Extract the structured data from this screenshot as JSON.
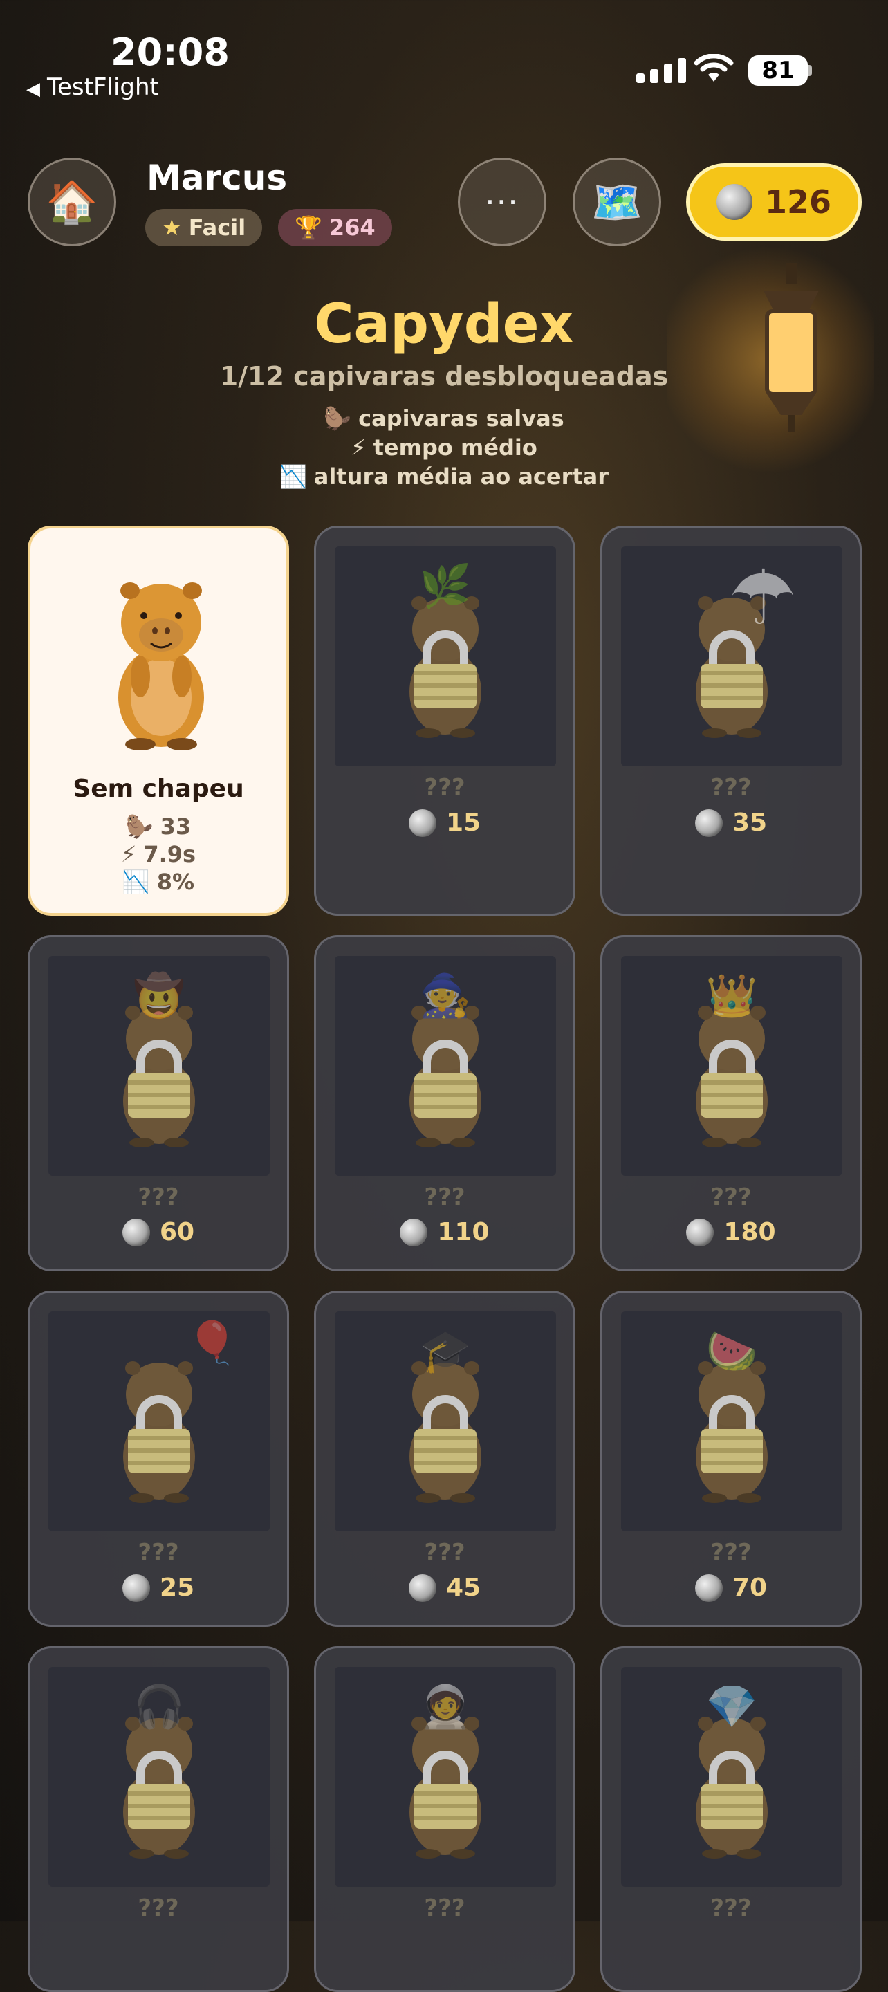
{
  "status_bar": {
    "time": "20:08",
    "back_label": "TestFlight",
    "battery": "81"
  },
  "header": {
    "home_icon": "🏠",
    "username": "Marcus",
    "level_icon": "★",
    "level": "Facil",
    "trophy_icon": "🏆",
    "trophies": "264",
    "more_label": "···",
    "map_icon": "🗺️",
    "coins": "126"
  },
  "page": {
    "title": "Capydex",
    "subtitle": "1/12 capivaras desbloqueadas",
    "legend": [
      {
        "icon": "🦫",
        "label": "capivaras salvas"
      },
      {
        "icon": "⚡",
        "label": "tempo médio"
      },
      {
        "icon": "📉",
        "label": "altura média ao acertar"
      }
    ]
  },
  "cards": [
    {
      "unlocked": true,
      "name": "Sem chapeu",
      "saved_icon": "🦫",
      "saved": "33",
      "time_icon": "⚡",
      "time": "7.9s",
      "height_icon": "📉",
      "height": "8%"
    },
    {
      "unlocked": false,
      "name": "???",
      "price": "15",
      "hat": "leaf"
    },
    {
      "unlocked": false,
      "name": "???",
      "price": "35",
      "hat": "umbrella"
    },
    {
      "unlocked": false,
      "name": "???",
      "price": "60",
      "hat": "cowboy"
    },
    {
      "unlocked": false,
      "name": "???",
      "price": "110",
      "hat": "wizard"
    },
    {
      "unlocked": false,
      "name": "???",
      "price": "180",
      "hat": "crown"
    },
    {
      "unlocked": false,
      "name": "???",
      "price": "25",
      "hat": "balloon"
    },
    {
      "unlocked": false,
      "name": "???",
      "price": "45",
      "hat": "graduation"
    },
    {
      "unlocked": false,
      "name": "???",
      "price": "70",
      "hat": "watermelon"
    },
    {
      "unlocked": false,
      "name": "???",
      "hat": "headphones"
    },
    {
      "unlocked": false,
      "name": "???",
      "hat": "astronaut"
    },
    {
      "unlocked": false,
      "name": "???",
      "hat": "tiara"
    }
  ],
  "colors": {
    "accent": "#f5c518",
    "title": "#ffd86b",
    "card_locked": "#3c3c42",
    "card_unlocked": "#fff7ee"
  }
}
